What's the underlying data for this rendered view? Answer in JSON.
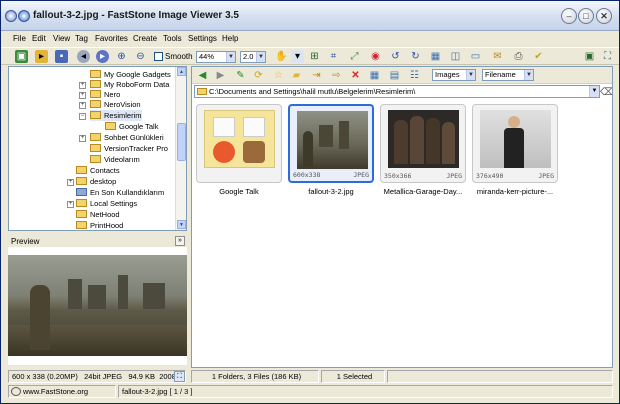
{
  "window": {
    "title": "fallout-3-2.jpg - FastStone Image Viewer 3.5"
  },
  "menu": [
    "File",
    "Edit",
    "View",
    "Tag",
    "Favorites",
    "Create",
    "Tools",
    "Settings",
    "Help"
  ],
  "toolbar": {
    "smooth_label": "Smooth",
    "zoom": "44%",
    "zoom2": "2.0"
  },
  "tree": [
    {
      "label": "My Google Gadgets"
    },
    {
      "label": "My RoboForm Data"
    },
    {
      "label": "Nero"
    },
    {
      "label": "NeroVision"
    },
    {
      "label": "Resimlerim"
    },
    {
      "label": "Google Talk"
    },
    {
      "label": "Sohbet Günlükleri"
    },
    {
      "label": "VersionTracker Pro"
    },
    {
      "label": "Videolarım"
    },
    {
      "label": "Contacts"
    },
    {
      "label": "desktop"
    },
    {
      "label": "En Son Kullandıklarım"
    },
    {
      "label": "Local Settings"
    },
    {
      "label": "NetHood"
    },
    {
      "label": "PrintHood"
    }
  ],
  "preview": {
    "label": "Preview",
    "collapse": "»"
  },
  "browser": {
    "filter": "Images",
    "sort": "Filename",
    "path": "C:\\Documents and Settings\\halil mutlu\\Belgelerim\\Resimlerim\\"
  },
  "thumbs": [
    {
      "caption": "Google Talk",
      "size": "",
      "type": ""
    },
    {
      "caption": "fallout-3-2.jpg",
      "size": "600x338",
      "type": "JPEG"
    },
    {
      "caption": "Metallica-Garage-Day...",
      "size": "350x366",
      "type": "JPEG"
    },
    {
      "caption": "miranda-kerr-picture-...",
      "size": "376x490",
      "type": "JPEG"
    }
  ],
  "status": {
    "dims": "600 x 338 (0.20MP)",
    "depth": "24bit JPEG",
    "filesize": "94.9 KB",
    "date": "2008-",
    "counts": "1 Folders, 3 Files (186 KB)",
    "selected": "1 Selected",
    "website": "www.FastStone.org",
    "current": "fallout-3-2.jpg [ 1 / 3 ]"
  }
}
